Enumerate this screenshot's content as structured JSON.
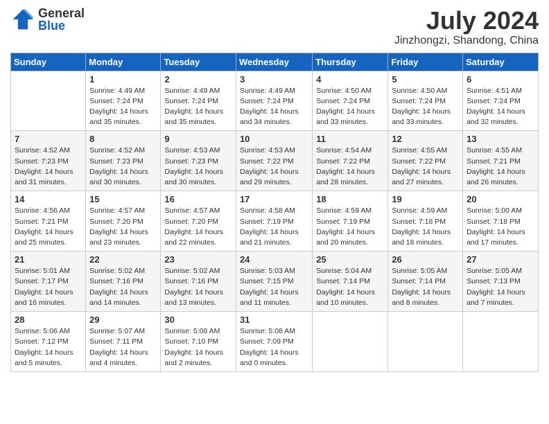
{
  "logo": {
    "general": "General",
    "blue": "Blue"
  },
  "title": "July 2024",
  "location": "Jinzhongzi, Shandong, China",
  "days_of_week": [
    "Sunday",
    "Monday",
    "Tuesday",
    "Wednesday",
    "Thursday",
    "Friday",
    "Saturday"
  ],
  "weeks": [
    [
      {
        "day": "",
        "sunrise": "",
        "sunset": "",
        "daylight": ""
      },
      {
        "day": "1",
        "sunrise": "Sunrise: 4:49 AM",
        "sunset": "Sunset: 7:24 PM",
        "daylight": "Daylight: 14 hours and 35 minutes."
      },
      {
        "day": "2",
        "sunrise": "Sunrise: 4:49 AM",
        "sunset": "Sunset: 7:24 PM",
        "daylight": "Daylight: 14 hours and 35 minutes."
      },
      {
        "day": "3",
        "sunrise": "Sunrise: 4:49 AM",
        "sunset": "Sunset: 7:24 PM",
        "daylight": "Daylight: 14 hours and 34 minutes."
      },
      {
        "day": "4",
        "sunrise": "Sunrise: 4:50 AM",
        "sunset": "Sunset: 7:24 PM",
        "daylight": "Daylight: 14 hours and 33 minutes."
      },
      {
        "day": "5",
        "sunrise": "Sunrise: 4:50 AM",
        "sunset": "Sunset: 7:24 PM",
        "daylight": "Daylight: 14 hours and 33 minutes."
      },
      {
        "day": "6",
        "sunrise": "Sunrise: 4:51 AM",
        "sunset": "Sunset: 7:24 PM",
        "daylight": "Daylight: 14 hours and 32 minutes."
      }
    ],
    [
      {
        "day": "7",
        "sunrise": "Sunrise: 4:52 AM",
        "sunset": "Sunset: 7:23 PM",
        "daylight": "Daylight: 14 hours and 31 minutes."
      },
      {
        "day": "8",
        "sunrise": "Sunrise: 4:52 AM",
        "sunset": "Sunset: 7:23 PM",
        "daylight": "Daylight: 14 hours and 30 minutes."
      },
      {
        "day": "9",
        "sunrise": "Sunrise: 4:53 AM",
        "sunset": "Sunset: 7:23 PM",
        "daylight": "Daylight: 14 hours and 30 minutes."
      },
      {
        "day": "10",
        "sunrise": "Sunrise: 4:53 AM",
        "sunset": "Sunset: 7:22 PM",
        "daylight": "Daylight: 14 hours and 29 minutes."
      },
      {
        "day": "11",
        "sunrise": "Sunrise: 4:54 AM",
        "sunset": "Sunset: 7:22 PM",
        "daylight": "Daylight: 14 hours and 28 minutes."
      },
      {
        "day": "12",
        "sunrise": "Sunrise: 4:55 AM",
        "sunset": "Sunset: 7:22 PM",
        "daylight": "Daylight: 14 hours and 27 minutes."
      },
      {
        "day": "13",
        "sunrise": "Sunrise: 4:55 AM",
        "sunset": "Sunset: 7:21 PM",
        "daylight": "Daylight: 14 hours and 26 minutes."
      }
    ],
    [
      {
        "day": "14",
        "sunrise": "Sunrise: 4:56 AM",
        "sunset": "Sunset: 7:21 PM",
        "daylight": "Daylight: 14 hours and 25 minutes."
      },
      {
        "day": "15",
        "sunrise": "Sunrise: 4:57 AM",
        "sunset": "Sunset: 7:20 PM",
        "daylight": "Daylight: 14 hours and 23 minutes."
      },
      {
        "day": "16",
        "sunrise": "Sunrise: 4:57 AM",
        "sunset": "Sunset: 7:20 PM",
        "daylight": "Daylight: 14 hours and 22 minutes."
      },
      {
        "day": "17",
        "sunrise": "Sunrise: 4:58 AM",
        "sunset": "Sunset: 7:19 PM",
        "daylight": "Daylight: 14 hours and 21 minutes."
      },
      {
        "day": "18",
        "sunrise": "Sunrise: 4:59 AM",
        "sunset": "Sunset: 7:19 PM",
        "daylight": "Daylight: 14 hours and 20 minutes."
      },
      {
        "day": "19",
        "sunrise": "Sunrise: 4:59 AM",
        "sunset": "Sunset: 7:18 PM",
        "daylight": "Daylight: 14 hours and 18 minutes."
      },
      {
        "day": "20",
        "sunrise": "Sunrise: 5:00 AM",
        "sunset": "Sunset: 7:18 PM",
        "daylight": "Daylight: 14 hours and 17 minutes."
      }
    ],
    [
      {
        "day": "21",
        "sunrise": "Sunrise: 5:01 AM",
        "sunset": "Sunset: 7:17 PM",
        "daylight": "Daylight: 14 hours and 16 minutes."
      },
      {
        "day": "22",
        "sunrise": "Sunrise: 5:02 AM",
        "sunset": "Sunset: 7:16 PM",
        "daylight": "Daylight: 14 hours and 14 minutes."
      },
      {
        "day": "23",
        "sunrise": "Sunrise: 5:02 AM",
        "sunset": "Sunset: 7:16 PM",
        "daylight": "Daylight: 14 hours and 13 minutes."
      },
      {
        "day": "24",
        "sunrise": "Sunrise: 5:03 AM",
        "sunset": "Sunset: 7:15 PM",
        "daylight": "Daylight: 14 hours and 11 minutes."
      },
      {
        "day": "25",
        "sunrise": "Sunrise: 5:04 AM",
        "sunset": "Sunset: 7:14 PM",
        "daylight": "Daylight: 14 hours and 10 minutes."
      },
      {
        "day": "26",
        "sunrise": "Sunrise: 5:05 AM",
        "sunset": "Sunset: 7:14 PM",
        "daylight": "Daylight: 14 hours and 8 minutes."
      },
      {
        "day": "27",
        "sunrise": "Sunrise: 5:05 AM",
        "sunset": "Sunset: 7:13 PM",
        "daylight": "Daylight: 14 hours and 7 minutes."
      }
    ],
    [
      {
        "day": "28",
        "sunrise": "Sunrise: 5:06 AM",
        "sunset": "Sunset: 7:12 PM",
        "daylight": "Daylight: 14 hours and 5 minutes."
      },
      {
        "day": "29",
        "sunrise": "Sunrise: 5:07 AM",
        "sunset": "Sunset: 7:11 PM",
        "daylight": "Daylight: 14 hours and 4 minutes."
      },
      {
        "day": "30",
        "sunrise": "Sunrise: 5:08 AM",
        "sunset": "Sunset: 7:10 PM",
        "daylight": "Daylight: 14 hours and 2 minutes."
      },
      {
        "day": "31",
        "sunrise": "Sunrise: 5:08 AM",
        "sunset": "Sunset: 7:09 PM",
        "daylight": "Daylight: 14 hours and 0 minutes."
      },
      {
        "day": "",
        "sunrise": "",
        "sunset": "",
        "daylight": ""
      },
      {
        "day": "",
        "sunrise": "",
        "sunset": "",
        "daylight": ""
      },
      {
        "day": "",
        "sunrise": "",
        "sunset": "",
        "daylight": ""
      }
    ]
  ]
}
